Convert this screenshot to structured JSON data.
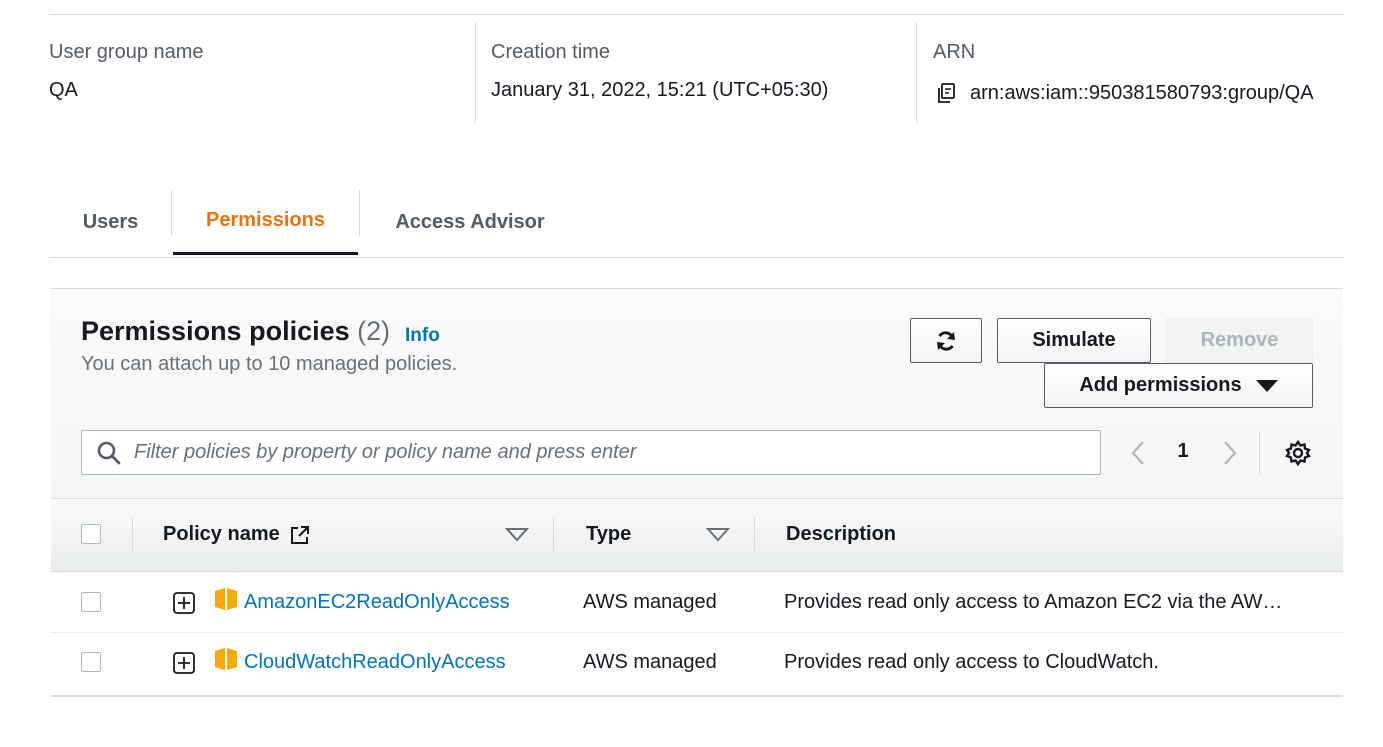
{
  "summary": {
    "group_name_label": "User group name",
    "group_name": "QA",
    "creation_label": "Creation time",
    "creation_time": "January 31, 2022, 15:21 (UTC+05:30)",
    "arn_label": "ARN",
    "arn": "arn:aws:iam::950381580793:group/QA"
  },
  "tabs": [
    {
      "label": "Users",
      "active": false
    },
    {
      "label": "Permissions",
      "active": true
    },
    {
      "label": "Access Advisor",
      "active": false
    }
  ],
  "panel": {
    "title": "Permissions policies",
    "count": "(2)",
    "info": "Info",
    "description": "You can attach up to 10 managed policies."
  },
  "buttons": {
    "refresh_icon": "refresh-icon",
    "simulate": "Simulate",
    "remove": "Remove",
    "add_permissions": "Add permissions"
  },
  "search": {
    "placeholder": "Filter policies by property or policy name and press enter",
    "value": ""
  },
  "pagination": {
    "current_page": "1"
  },
  "table": {
    "headers": {
      "policy_name": "Policy name",
      "type": "Type",
      "description": "Description"
    },
    "rows": [
      {
        "name": "AmazonEC2ReadOnlyAccess",
        "type": "AWS managed",
        "description": "Provides read only access to Amazon EC2 via the AW…"
      },
      {
        "name": "CloudWatchReadOnlyAccess",
        "type": "AWS managed",
        "description": "Provides read only access to CloudWatch."
      }
    ]
  },
  "colors": {
    "accent_orange": "#ec7211",
    "link_blue": "#0073bb",
    "policy_icon": "#f7a80d"
  }
}
